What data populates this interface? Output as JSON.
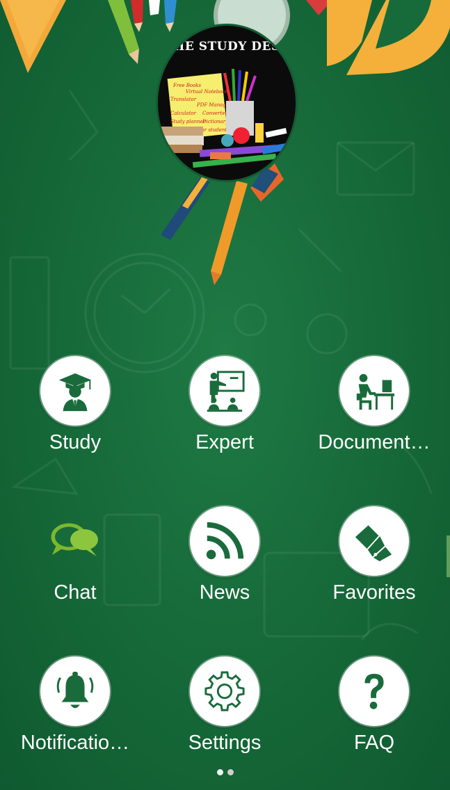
{
  "app": {
    "logo_text": "HE STUDY DES",
    "logo_notes": [
      "Free Books",
      "Virtual Notebook",
      "Translator",
      "PDF Manager",
      "Calculator",
      "Converter",
      "Study planner",
      "Dictionary",
      "One stop for student"
    ]
  },
  "menu": [
    {
      "label": "Study",
      "icon": "graduate-icon"
    },
    {
      "label": "Expert",
      "icon": "teacher-board-icon"
    },
    {
      "label": "Document…",
      "icon": "desk-computer-icon"
    },
    {
      "label": "Chat",
      "icon": "chat-bubbles-icon"
    },
    {
      "label": "News",
      "icon": "rss-icon"
    },
    {
      "label": "Favorites",
      "icon": "color-swatches-icon"
    },
    {
      "label": "Notificatio…",
      "icon": "bell-icon"
    },
    {
      "label": "Settings",
      "icon": "gear-icon"
    },
    {
      "label": "FAQ",
      "icon": "question-mark-icon"
    }
  ],
  "pager": {
    "pages": 2,
    "current": 1
  },
  "colors": {
    "background": "#176b3a",
    "icon_green": "#1a6b3c",
    "chat_green": "#7cb82f"
  }
}
